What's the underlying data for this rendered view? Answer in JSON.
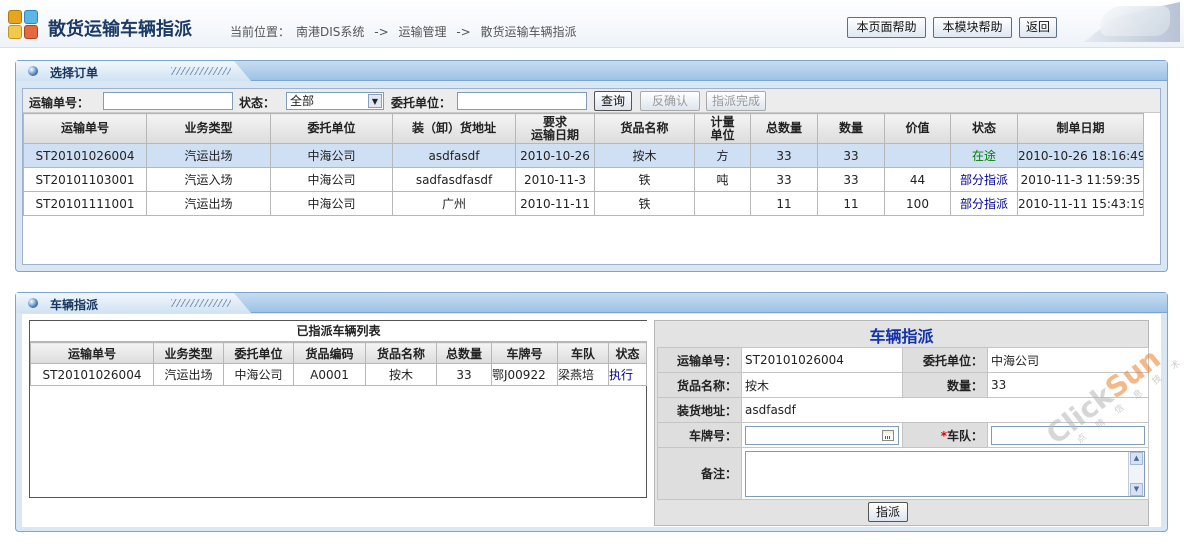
{
  "header": {
    "title": "散货运输车辆指派",
    "breadcrumb_label": "当前位置：",
    "breadcrumb": [
      "南港DIS系统",
      "->",
      "运输管理",
      "->",
      "散货运输车辆指派"
    ],
    "help_page_label": "本页面帮助",
    "help_module_label": "本模块帮助",
    "back_label": "返回"
  },
  "order_panel": {
    "title": "选择订单",
    "search": {
      "waybill_label": "运输单号：",
      "waybill_value": "",
      "status_label": "状态：",
      "status_selected": "全部",
      "client_label": "委托单位：",
      "client_value": "",
      "query_label": "查询",
      "unconfirm_label": "反确认",
      "complete_label": "指派完成"
    },
    "columns": [
      "运输单号",
      "业务类型",
      "委托单位",
      "装（卸）货地址",
      "要求\n运输日期",
      "货品名称",
      "计量\n单位",
      "总数量",
      "数量",
      "价值",
      "状态",
      "制单日期"
    ],
    "rows": [
      {
        "id": "ST20101026004",
        "type": "汽运出场",
        "client": "中海公司",
        "address": "asdfasdf",
        "date": "2010-10-26",
        "goods": "按木",
        "unit": "方",
        "total": "33",
        "qty": "33",
        "value": "",
        "status": "在途",
        "created": "2010-10-26 18:16:49"
      },
      {
        "id": "ST20101103001",
        "type": "汽运入场",
        "client": "中海公司",
        "address": "sadfasdfasdf",
        "date": "2010-11-3",
        "goods": "铁",
        "unit": "吨",
        "total": "33",
        "qty": "33",
        "value": "44",
        "status": "部分指派",
        "created": "2010-11-3 11:59:35"
      },
      {
        "id": "ST20101111001",
        "type": "汽运出场",
        "client": "中海公司",
        "address": "广州",
        "date": "2010-11-11",
        "goods": "铁",
        "unit": "",
        "total": "11",
        "qty": "11",
        "value": "100",
        "status": "部分指派",
        "created": "2010-11-11 15:43:19"
      }
    ]
  },
  "vehicle_panel": {
    "title": "车辆指派",
    "assigned": {
      "caption": "已指派车辆列表",
      "columns": [
        "运输单号",
        "业务类型",
        "委托单位",
        "货品编码",
        "货品名称",
        "总数量",
        "车牌号",
        "车队",
        "状态"
      ],
      "rows": [
        {
          "id": "ST20101026004",
          "type": "汽运出场",
          "client": "中海公司",
          "code": "A0001",
          "goods": "按木",
          "total": "33",
          "plate": "鄂J00922",
          "fleet": "梁燕培",
          "status": "执行"
        }
      ]
    },
    "form": {
      "title": "车辆指派",
      "waybill_label": "运输单号：",
      "waybill_value": "ST20101026004",
      "client_label": "委托单位：",
      "client_value": "中海公司",
      "goods_label": "货品名称：",
      "goods_value": "按木",
      "qty_label": "数量：",
      "qty_value": "33",
      "address_label": "装货地址：",
      "address_value": "asdfasdf",
      "plate_label": "车牌号：",
      "plate_value": "",
      "required_mark": "*",
      "fleet_label": "车队：",
      "fleet_value": "",
      "remark_label": "备注：",
      "remark_value": "",
      "assign_label": "指派"
    }
  },
  "watermark": {
    "brand_a": "Click",
    "brand_b": "Sun",
    "sub": "点 睛 信 息 技 术"
  },
  "colors": {
    "panel_border": "#7aa6cf",
    "selected_row": "#cfe0f4",
    "status_in_transit": "#008000",
    "status_partial": "#000099",
    "form_title": "#1234a8"
  }
}
